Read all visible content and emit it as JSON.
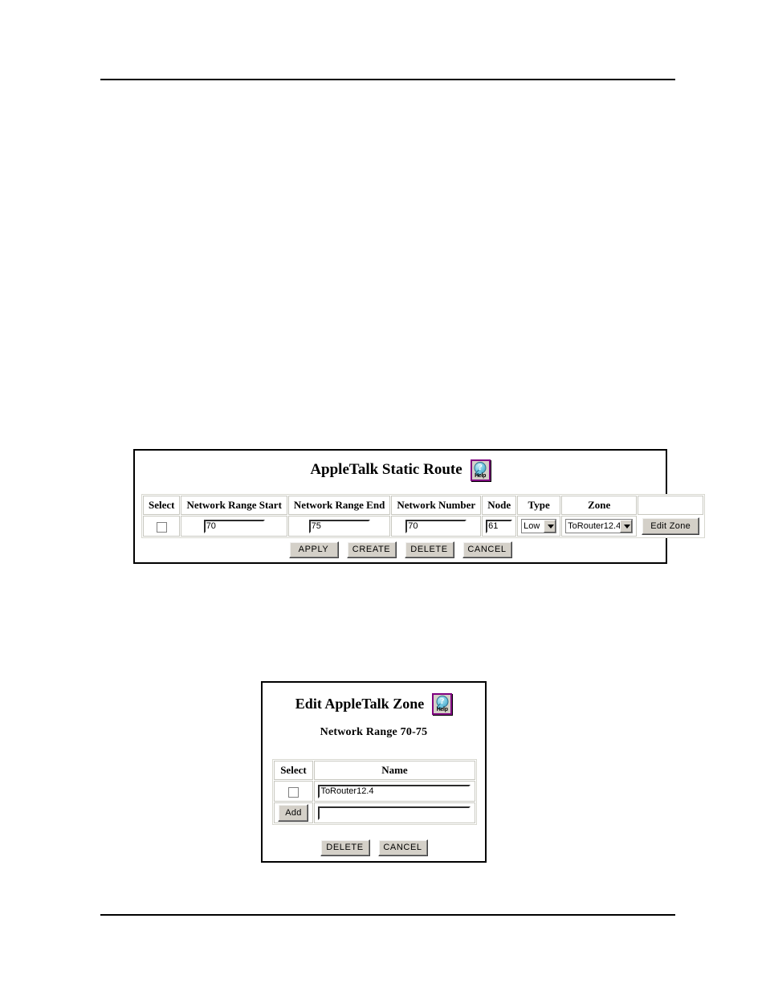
{
  "page": {
    "has_top_rule": true,
    "has_bottom_rule": true,
    "background": "#ffffff"
  },
  "static_route_panel": {
    "title": "AppleTalk Static Route",
    "help_icon": {
      "name": "help-icon",
      "symbol": "?",
      "label": "Help",
      "border_color": "#800080"
    },
    "table": {
      "headers": [
        "Select",
        "Network Range Start",
        "Network Range End",
        "Network Number",
        "Node",
        "Type",
        "Zone",
        ""
      ],
      "row": {
        "select_checked": false,
        "network_range_start": "70",
        "network_range_end": "75",
        "network_number": "70",
        "node": "61",
        "type": "Low",
        "type_options": [
          "Low"
        ],
        "zone": "ToRouter12.4",
        "zone_options": [
          "ToRouter12.4"
        ],
        "edit_zone_label": "Edit Zone"
      }
    },
    "buttons": [
      "APPLY",
      "CREATE",
      "DELETE",
      "CANCEL"
    ]
  },
  "edit_zone_panel": {
    "title": "Edit AppleTalk Zone",
    "subtitle": "Network Range 70-75",
    "help_icon": {
      "name": "help-icon",
      "symbol": "?",
      "label": "Help",
      "border_color": "#800080"
    },
    "table": {
      "headers": [
        "Select",
        "Name"
      ],
      "rows": [
        {
          "select_checked": false,
          "name": "ToRouter12.4"
        }
      ],
      "add_row": {
        "add_label": "Add",
        "name": "",
        "name_placeholder": ""
      }
    },
    "buttons": [
      "DELETE",
      "CANCEL"
    ]
  }
}
